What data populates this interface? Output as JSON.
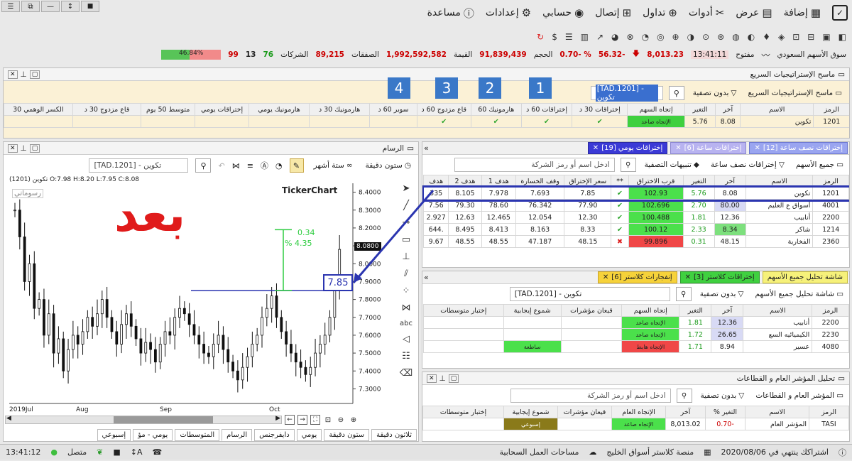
{
  "window": {
    "buttons": [
      "☰",
      "⧉",
      "—",
      "↕",
      "■"
    ]
  },
  "menu": {
    "items": [
      "إضافة",
      "عرض",
      "أدوات",
      "تداول",
      "إتصال",
      "حسابي",
      "إعدادات",
      "مساعدة"
    ]
  },
  "ticker": {
    "market": "سوق الأسهم السعودي",
    "status": "مفتوح",
    "time": "13:41:11",
    "index": "8,013.23",
    "change": "-56.32",
    "change_pct": "% -0.70",
    "volume_label": "الحجم",
    "volume": "91,839,439",
    "value_label": "القيمة",
    "value": "1,992,592,582",
    "deals_label": "الصفقات",
    "deals": "89,215",
    "companies_label": "الشركات",
    "up": "76",
    "unch": "13",
    "down": "99",
    "bar_pct": "46.84%"
  },
  "scanner": {
    "title": "ماسح الإستراتيجيات السريع",
    "filter_btn": "ماسح الإستراتيجيات السريع",
    "nofilter": "بدون تصفية",
    "search_value": "[TAD.1201] - تكوين",
    "numbers": [
      "1",
      "2",
      "3",
      "4"
    ],
    "headers": [
      "الرمز",
      "الاسم",
      "آخر",
      "التغير",
      "إتجاه السهم",
      "إختراقات 30 د",
      "إختراقات 60 د",
      "هارمونيك 60",
      "قاع مزدوج 60 د",
      "سوبر 60 د",
      "هارمونيك 30 د",
      "هارمونيك يومي",
      "إختراقات يومي",
      "متوسط 50 يوم",
      "قاع مزدوج 30 د",
      "الكسر الوهمي 30"
    ],
    "row": {
      "symbol": "1201",
      "name": "تكوين",
      "last": "8.08",
      "change": "5.76",
      "trend": "الإتجاه صاعد"
    }
  },
  "alerts": {
    "tabs": [
      "إختراقات نصف ساعة [12]",
      "إختراقات ساعة [6]",
      "إختراقات يومي [19]"
    ],
    "all_stocks": "جميع الأسهم",
    "hour_breaks": "إختراقات نصف ساعة",
    "filter_alerts": "تنبيهات التصفية",
    "search_placeholder": "ادخل اسم أو رمز الشركة",
    "headers": [
      "الرمز",
      "الاسم",
      "آخر",
      "التغير",
      "قرب الاختراق",
      "**",
      "سعر الإختراق",
      "وقف الخسارة",
      "هدف 1",
      "هدف 2",
      "هدف"
    ],
    "rows": [
      {
        "sym": "1201",
        "name": "تكوين",
        "last": "8.08",
        "chg": "5.76",
        "near": "102.93",
        "mark": "✔",
        "brk": "7.85",
        "stop": "7.693",
        "t1": "7.978",
        "t2": "8.105",
        "t3": "335"
      },
      {
        "sym": "4001",
        "name": "أسواق ع العليم",
        "last": "80.00",
        "chg": "2.70",
        "near": "102.696",
        "mark": "✔",
        "brk": "77.90",
        "stop": "76.342",
        "t1": "78.60",
        "t2": "79.30",
        "t3": "7.56"
      },
      {
        "sym": "2200",
        "name": "أنابيب",
        "last": "12.36",
        "chg": "1.81",
        "near": "100.488",
        "mark": "✔",
        "brk": "12.30",
        "stop": "12.054",
        "t1": "12.465",
        "t2": "12.63",
        "t3": "2.927"
      },
      {
        "sym": "1214",
        "name": "شاكر",
        "last": "8.34",
        "chg": "2.33",
        "near": "100.12",
        "mark": "✔",
        "brk": "8.33",
        "stop": "8.163",
        "t1": "8.413",
        "t2": "8.495",
        "t3": ".644"
      },
      {
        "sym": "2360",
        "name": "الفخارية",
        "last": "48.15",
        "chg": "0.31",
        "near": "99.896",
        "mark": "✖",
        "brk": "48.15",
        "stop": "47.187",
        "t1": "48.55",
        "t2": "48.55",
        "t3": "9.67"
      }
    ]
  },
  "analysis": {
    "title": "شاشة تحليل جميع الأسهم",
    "tabs": [
      "إختراقات كلاستر [3]",
      "إنفجارات كلاستر [6]"
    ],
    "search_value": "[TAD.1201] - تكوين",
    "nofilter": "بدون تصفية",
    "headers": [
      "الرمز",
      "الاسم",
      "آخر",
      "التغير",
      "إتجاه السهم",
      "قيعان مؤشرات",
      "شموع إيجابية",
      "إختبار متوسطات"
    ],
    "rows": [
      {
        "sym": "2200",
        "name": "أنابيب",
        "last": "12.36",
        "chg": "1.81",
        "trend": "الإتجاه صاعد",
        "candle": ""
      },
      {
        "sym": "2230",
        "name": "الكيميائيه السع",
        "last": "26.65",
        "chg": "1.72",
        "trend": "الإتجاه صاعد",
        "candle": ""
      },
      {
        "sym": "4080",
        "name": "عسير",
        "last": "8.94",
        "chg": "1.71",
        "trend": "الإتجاه هابط",
        "candle": "ساطعة"
      }
    ]
  },
  "sectors": {
    "title": "تحليل المؤشر العام و القطاعات",
    "sub": "المؤشر العام و القطاعات",
    "nofilter": "بدون تصفية",
    "search_placeholder": "ادخل اسم أو رمز الشركة",
    "headers": [
      "الرمز",
      "الاسم",
      "التغير %",
      "آخر",
      "الإتجاه العام",
      "قيعان مؤشرات",
      "شموع إيجابية",
      "إختبار متوسطات"
    ],
    "row": {
      "sym": "TASI",
      "name": "المؤشر العام",
      "chg": "-0.70",
      "last": "8,013.02",
      "trend": "الإتجاه صاعد",
      "candle": "إسبوعي"
    }
  },
  "chart": {
    "title": "الرسام",
    "search_value": "[TAD.1201] - تكوين",
    "period_a": "ستون دقيقة",
    "period_b": "ستة أشهر",
    "watermark": "TickerChart",
    "drawings": "رسوماتي",
    "ohlc": "O:7.98  H:8.20  L:7.95  C:8.08",
    "symbol_label": "(1201) تكوين",
    "overlay_word": "بعد",
    "measure_top": "0.34",
    "measure_pct": "% 4.35",
    "price_box": "7.85",
    "last_label": "8.0800",
    "yticks": [
      "8.4000",
      "8.3000",
      "8.2000",
      "8.1000",
      "8.0000",
      "7.9000",
      "7.8000",
      "7.7000",
      "7.6000",
      "7.5000",
      "7.4000",
      "7.3000"
    ],
    "xticks": [
      "2019Jul",
      "Aug",
      "Sep",
      "Oct"
    ],
    "bottom_tabs": [
      "ثلاثون دقيقة",
      "ستون دقيقة",
      "يومي",
      "دايفرجنس",
      "الرسام",
      "المتوسطات",
      "يومي - مؤ",
      "إسبوعي"
    ]
  },
  "status": {
    "time": "13:41:12",
    "connected": "متصل",
    "cloud": "مساحات العمل السحابية",
    "platform": "منصة كلاستر أسواق الخليج",
    "subscription": "اشتراكك ينتهي في 2020/08/06"
  },
  "chart_data": {
    "type": "candlestick",
    "title": "",
    "xlabel": "",
    "ylabel": "",
    "ylim": [
      7.25,
      8.45
    ],
    "x": [
      "2019Jul",
      "Aug",
      "Sep",
      "Oct"
    ],
    "series": [
      {
        "values": [
          8.3,
          8.15,
          7.9,
          8.0,
          7.75,
          7.8,
          7.6,
          7.72,
          7.5,
          7.58,
          7.4,
          7.52,
          7.6,
          7.55,
          7.62,
          7.7,
          7.65,
          7.72,
          7.8,
          7.7,
          7.62,
          7.55,
          7.66,
          7.72,
          7.65,
          7.58,
          7.5,
          7.56,
          7.52,
          7.45,
          7.55,
          7.62,
          7.6,
          7.7,
          7.75,
          7.72,
          7.66,
          7.6,
          7.55,
          7.5,
          7.48,
          7.55,
          7.6,
          7.52,
          7.45,
          7.4,
          7.35,
          7.42,
          7.48,
          7.55,
          7.6,
          7.7,
          7.75,
          7.82,
          7.7,
          7.62,
          7.55,
          7.5,
          7.45,
          7.42,
          7.38,
          7.42,
          7.5,
          7.55,
          7.6,
          7.7,
          7.85,
          8.08
        ]
      }
    ]
  }
}
